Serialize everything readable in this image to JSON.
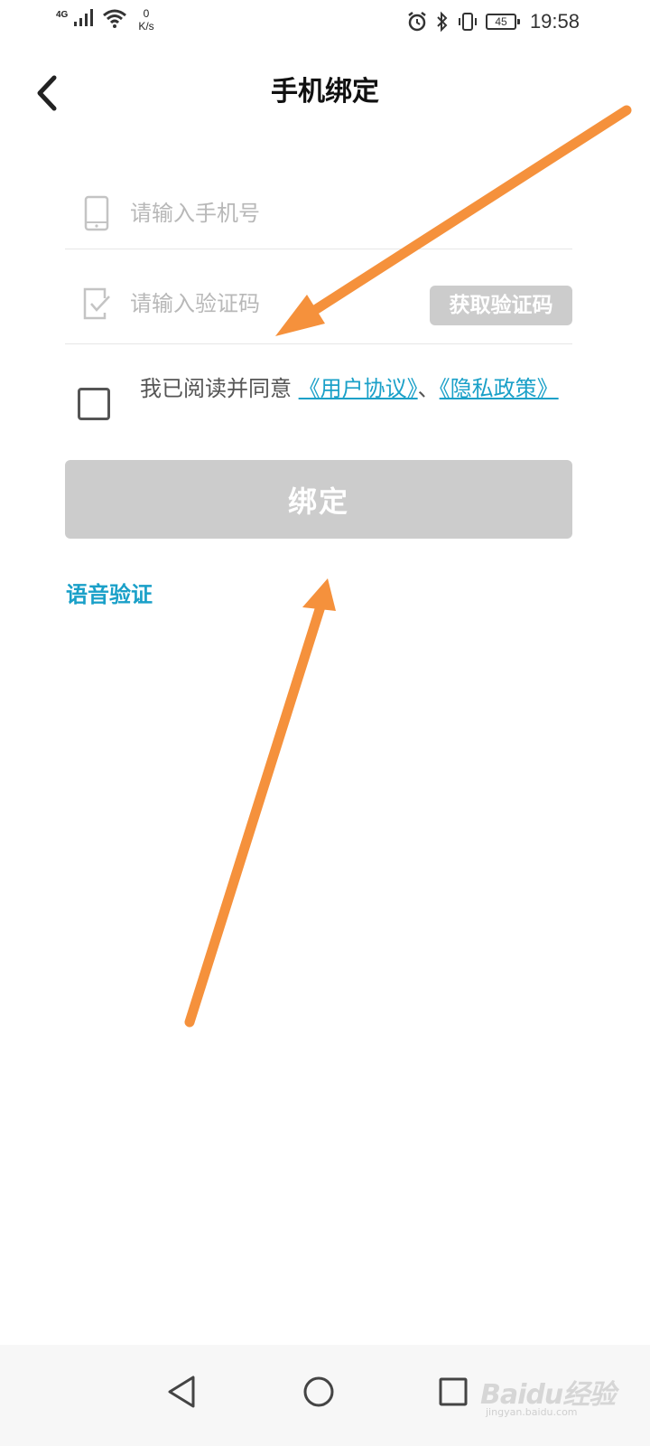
{
  "status_bar": {
    "network": "4G",
    "speed_value": "0",
    "speed_unit": "K/s",
    "battery": "45",
    "time": "19:58"
  },
  "header": {
    "title": "手机绑定",
    "back_icon": "chevron-left-icon"
  },
  "form": {
    "phone": {
      "placeholder": "请输入手机号",
      "value": "",
      "icon": "smartphone-icon"
    },
    "code": {
      "placeholder": "请输入验证码",
      "value": "",
      "icon": "verify-check-icon",
      "get_code_label": "获取验证码"
    }
  },
  "agreement": {
    "checked": false,
    "prefix": "我已阅读并同意 ",
    "user_agreement": "《用户协议》",
    "separator": "、",
    "privacy_policy": "《隐私政策》"
  },
  "bind_button_label": "绑定",
  "voice_verify_label": "语音验证",
  "navbar": {
    "back_icon": "triangle-back-icon",
    "home_icon": "circle-home-icon",
    "recent_icon": "square-recent-icon"
  },
  "watermark": {
    "logo": "Baidu经验",
    "subtitle": "jingyan.baidu.com"
  },
  "colors": {
    "link": "#1aa0c8",
    "disabled_button": "#cccccc",
    "placeholder": "#b8b8b8",
    "annotation_arrow": "#f5913c"
  }
}
